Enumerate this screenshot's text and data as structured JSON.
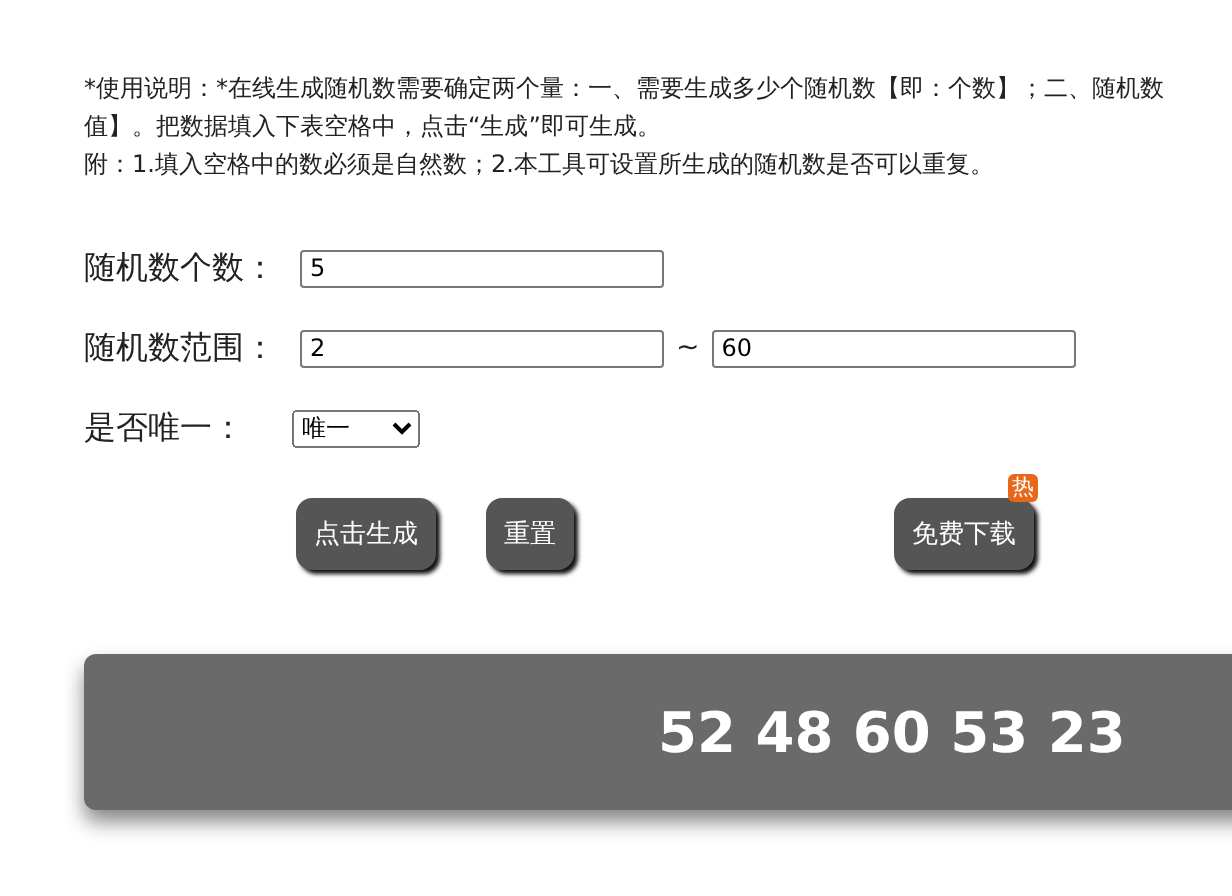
{
  "instructions": {
    "lines": [
      "*使用说明：*在线生成随机数需要确定两个量：一、需要生成多少个随机数【即：个数】；二、随机数",
      "值】。把数据填入下表空格中，点击“生成”即可生成。",
      "附：1.填入空格中的数必须是自然数；2.本工具可设置所生成的随机数是否可以重复。"
    ]
  },
  "form": {
    "count_label": "随机数个数：",
    "count_value": "5",
    "range_label": "随机数范围：",
    "range_min": "2",
    "range_separator": "~",
    "range_max": "60",
    "unique_label": "是否唯一：",
    "unique_value": "唯一"
  },
  "buttons": [
    {
      "label": "点击生成",
      "kind": "action"
    },
    {
      "label": "重置",
      "kind": "action"
    },
    {
      "label": "免费下载",
      "kind": "download",
      "badge": "热"
    }
  ],
  "result": "52 48 60 53 23"
}
